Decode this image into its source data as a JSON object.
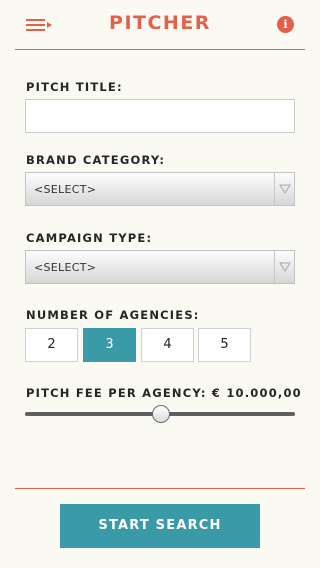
{
  "header": {
    "title": "PITCHER",
    "menu_icon": "menu-icon",
    "info_icon": "info-icon",
    "info_glyph": "i",
    "accent_color": "#e4604d"
  },
  "form": {
    "pitch_title": {
      "label": "PITCH TITLE:",
      "value": "",
      "placeholder": ""
    },
    "brand_category": {
      "label": "BRAND CATEGORY:",
      "selected": "<SELECT>"
    },
    "campaign_type": {
      "label": "CAMPAIGN TYPE:",
      "selected": "<SELECT>"
    },
    "agencies": {
      "label": "NUMBER OF AGENCIES:",
      "options": [
        "2",
        "3",
        "4",
        "5"
      ],
      "selected": "3",
      "active_color": "#3b9aa8"
    },
    "pitch_fee": {
      "label": "PITCH FEE PER AGENCY: € 10.000,00",
      "slider_fraction": 0.5
    }
  },
  "actions": {
    "start_label": "START SEARCH",
    "button_color": "#3b9aa8"
  }
}
